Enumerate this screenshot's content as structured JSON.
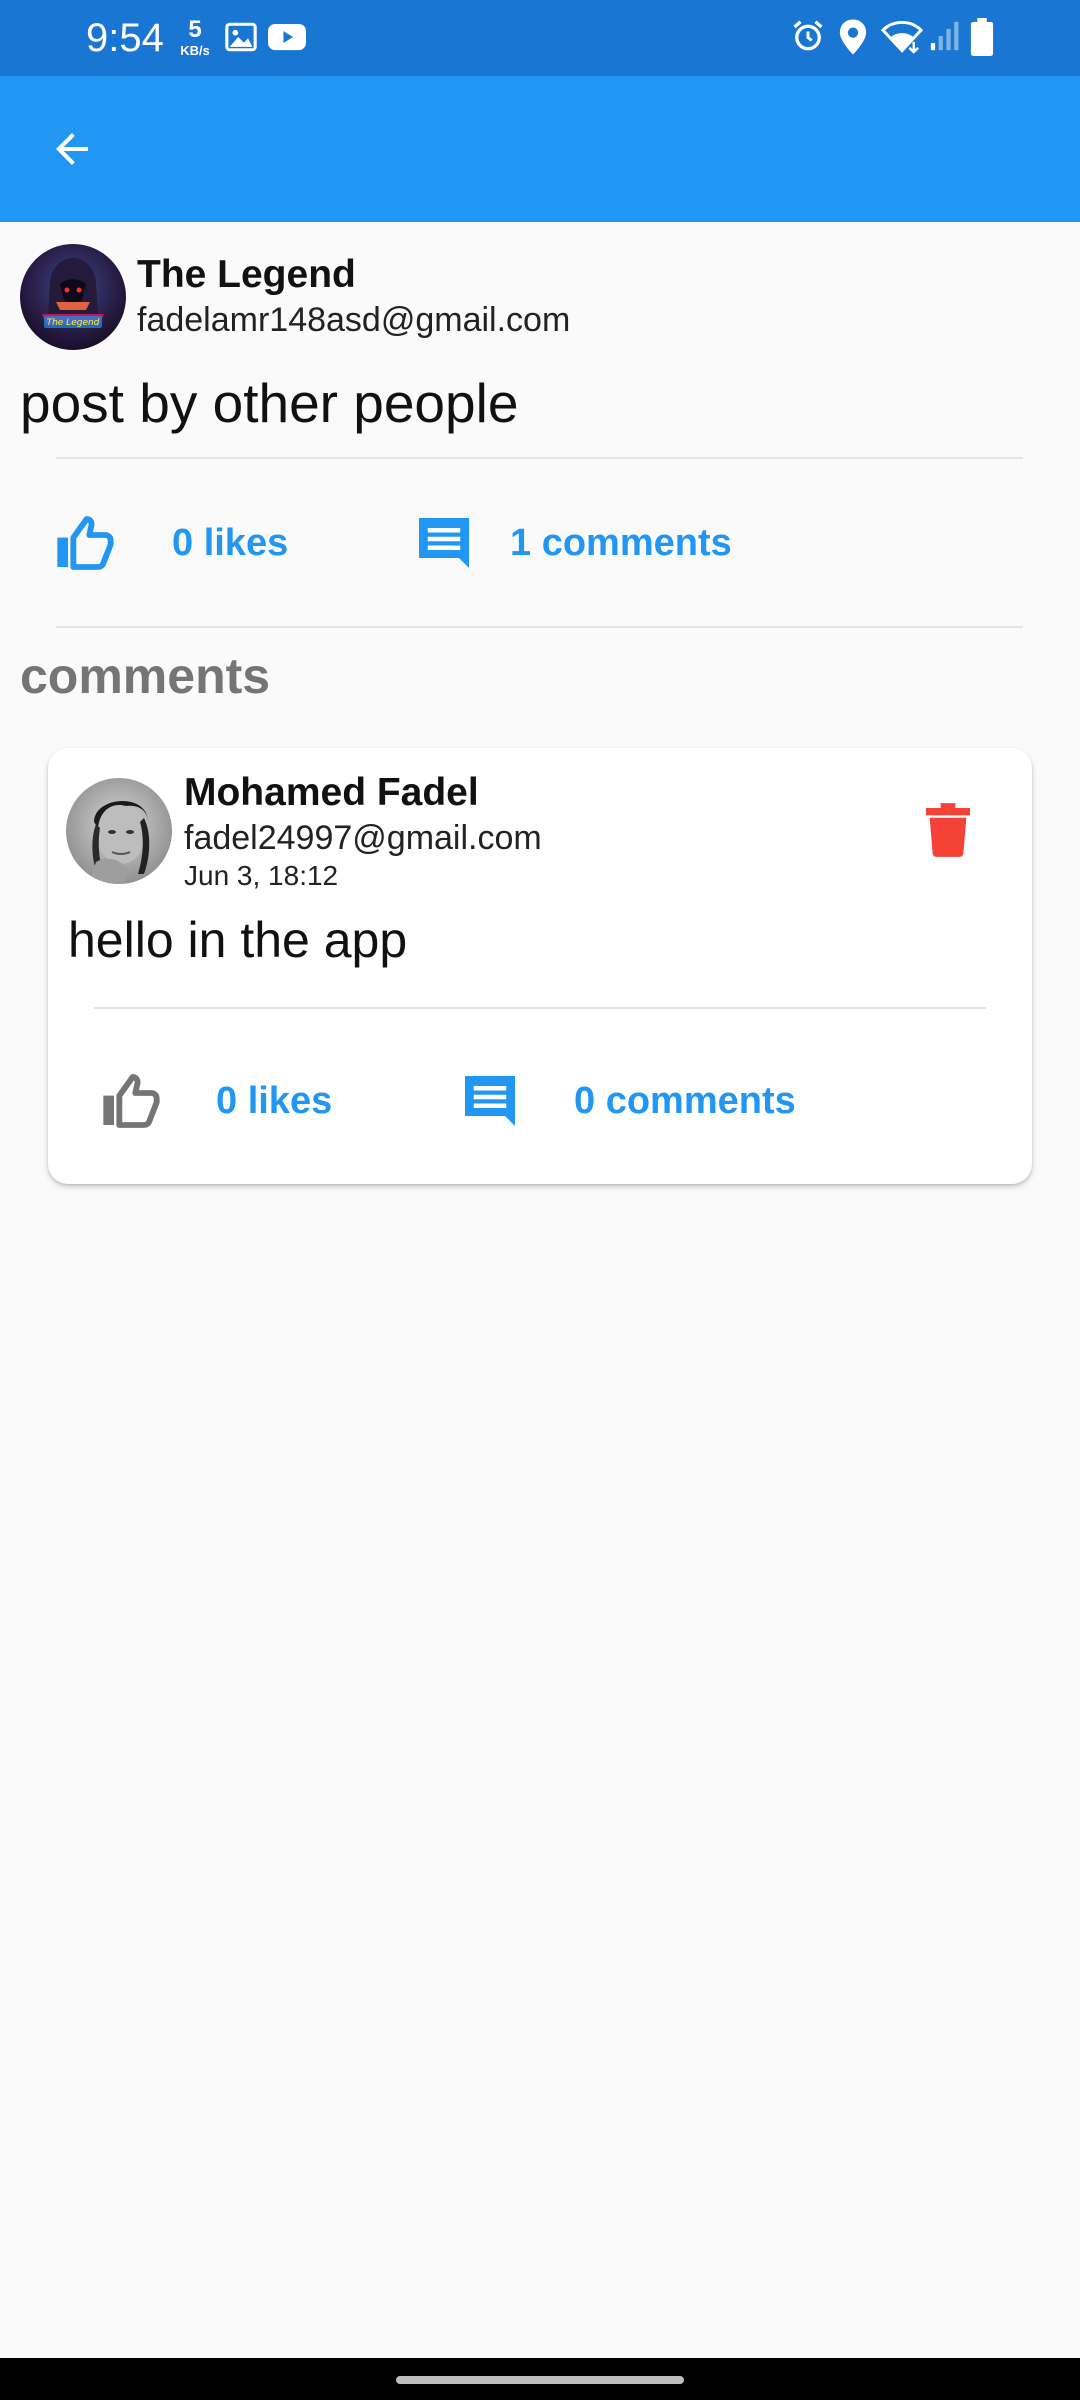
{
  "status_bar": {
    "time": "9:54",
    "net_speed_value": "5",
    "net_speed_unit": "KB/s",
    "left_icons": [
      "image-icon",
      "youtube-icon"
    ],
    "right_icons": [
      "alarm-icon",
      "location-icon",
      "wifi-icon",
      "signal-icon",
      "battery-icon"
    ]
  },
  "app_bar": {
    "back_icon": "arrow-back-icon"
  },
  "post": {
    "author_name": "The Legend",
    "author_email": "fadelamr148asd@gmail.com",
    "avatar_text": "The Legend",
    "text": "post by other people",
    "likes_label": "0 likes",
    "comments_label": "1 comments"
  },
  "comments_section": {
    "title": "comments",
    "items": [
      {
        "author_name": "Mohamed Fadel",
        "author_email": "fadel24997@gmail.com",
        "date": "Jun 3, 18:12",
        "text": "hello in the app",
        "likes_label": "0 likes",
        "comments_label": "0 comments"
      }
    ]
  },
  "colors": {
    "status_bar": "#1976d2",
    "app_bar": "#2196f3",
    "accent": "#2196f3",
    "delete": "#f44336",
    "section_title": "#757575",
    "background": "#fafafa"
  }
}
